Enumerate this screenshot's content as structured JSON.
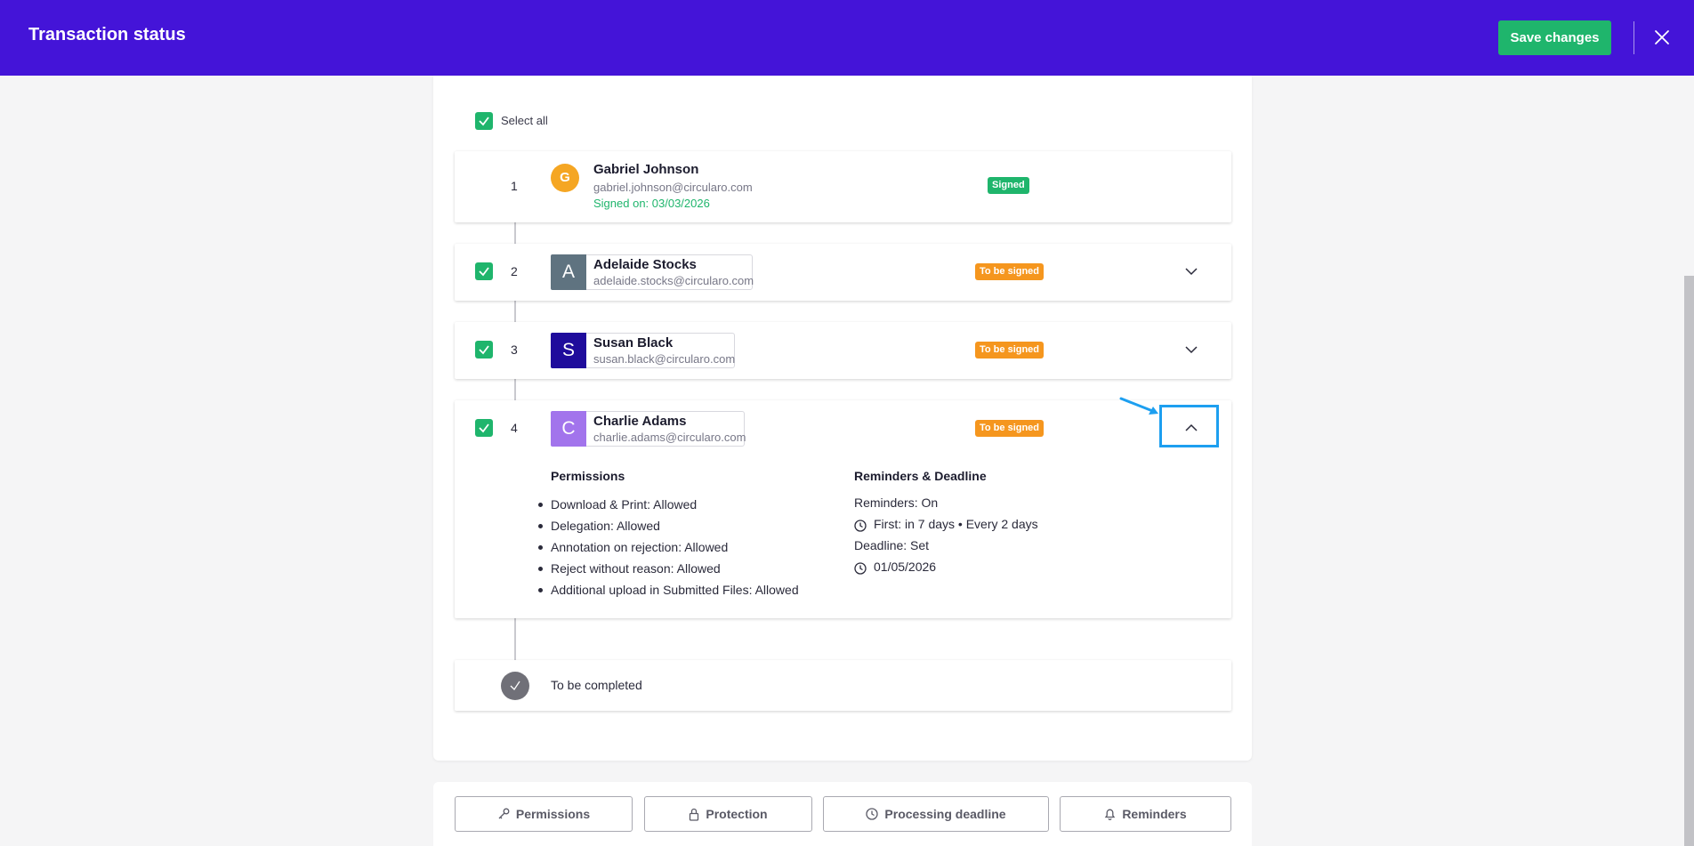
{
  "header": {
    "title": "Transaction status",
    "save_label": "Save changes"
  },
  "select_all": {
    "label": "Select all",
    "checked": true
  },
  "signers": [
    {
      "order": "1",
      "initial": "G",
      "name": "Gabriel Johnson",
      "email": "gabriel.johnson@circularo.com",
      "signed_on": "Signed on: 03/03/2026",
      "status": "Signed",
      "avatar_color": "#f5a623"
    },
    {
      "order": "2",
      "initial": "A",
      "name": "Adelaide Stocks",
      "email": "adelaide.stocks@circularo.com",
      "status": "To be signed",
      "avatar_color": "#5f7380",
      "checked": true
    },
    {
      "order": "3",
      "initial": "S",
      "name": "Susan Black",
      "email": "susan.black@circularo.com",
      "status": "To be signed",
      "avatar_color": "#1f0c9c",
      "checked": true
    },
    {
      "order": "4",
      "initial": "C",
      "name": "Charlie Adams",
      "email": "charlie.adams@circularo.com",
      "status": "To be signed",
      "avatar_color": "#a274ec",
      "checked": true,
      "expanded": true
    }
  ],
  "details": {
    "permissions_title": "Permissions",
    "permissions": [
      "Download & Print: Allowed",
      "Delegation: Allowed",
      "Annotation on rejection: Allowed",
      "Reject without reason: Allowed",
      "Additional upload in Submitted Files: Allowed"
    ],
    "reminders_title": "Reminders & Deadline",
    "reminders_status": "Reminders: On",
    "reminders_schedule": "First: in 7 days • Every 2 days",
    "deadline_status": "Deadline: Set",
    "deadline_date": "01/05/2026"
  },
  "completion": {
    "label": "To be completed"
  },
  "bottom_tabs": {
    "permissions": "Permissions",
    "protection": "Protection",
    "processing_deadline": "Processing deadline",
    "reminders": "Reminders"
  },
  "colors": {
    "header_bg": "#4414d8",
    "accent_green": "#1fb56c",
    "pending_orange": "#f5961e",
    "highlight_blue": "#1d9ff0"
  },
  "icons": {
    "close": "close-icon",
    "check": "check-icon",
    "chevron_down": "chevron-down-icon",
    "chevron_up": "chevron-up-icon",
    "clock": "clock-icon",
    "key": "key-icon",
    "lock": "lock-icon",
    "bell": "bell-icon"
  }
}
